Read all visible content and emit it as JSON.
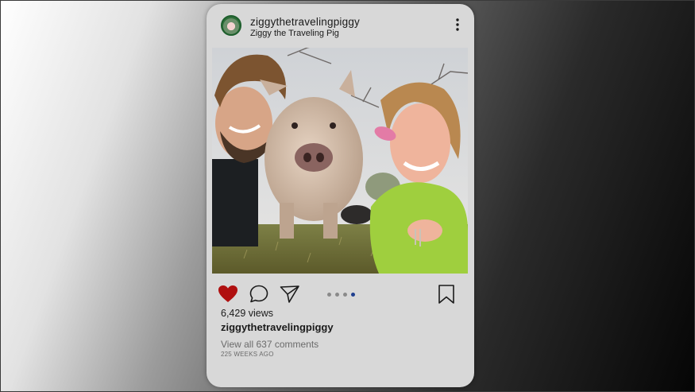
{
  "post": {
    "username": "ziggythetravelingpiggy",
    "display_name": "Ziggy the Traveling Pig",
    "views": "6,429 views",
    "caption_username": "ziggythetravelingpiggy",
    "view_comments": "View all 637 comments",
    "timestamp": "225 WEEKS  AGO"
  },
  "carousel": {
    "total": 4,
    "active_index": 4
  },
  "icons": {
    "more": "more-vertical-icon",
    "like": "heart-icon",
    "comment": "comment-icon",
    "share": "paper-plane-icon",
    "save": "bookmark-icon"
  },
  "colors": {
    "like_red": "#b01010",
    "active_dot": "#1f3f8f",
    "inactive_dot": "#8a8a8a",
    "card": "#d8d8d8"
  }
}
